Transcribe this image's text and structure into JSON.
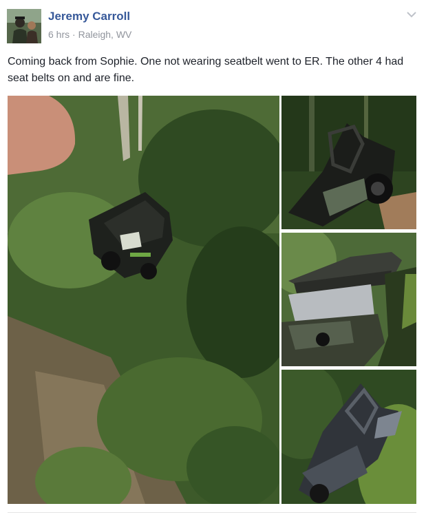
{
  "post": {
    "author": "Jeremy Carroll",
    "time": "6 hrs",
    "separator": "·",
    "location": "Raleigh, WV",
    "message": "Coming back from Sophie. One not wearing seatbelt went to ER. The other 4 had seat belts on and are fine."
  },
  "icons": {
    "menu": "chevron-down-icon"
  },
  "colors": {
    "author_link": "#365899",
    "meta_text": "#90949c",
    "body_text": "#1d2129"
  }
}
